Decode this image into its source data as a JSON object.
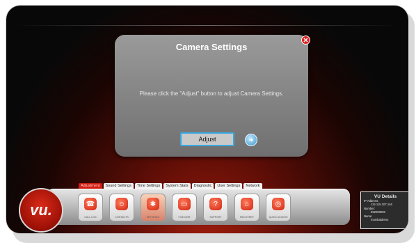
{
  "dialog": {
    "title": "Camera Settings",
    "message": "Please click the \"Adjust\" button to adjust Camera Settings.",
    "adjust_label": "Adjust"
  },
  "tabs": [
    {
      "label": "Adjustment",
      "active": true
    },
    {
      "label": "Sound Settings",
      "active": false
    },
    {
      "label": "Time Settings",
      "active": false
    },
    {
      "label": "System Stats",
      "active": false
    },
    {
      "label": "Diagnostic",
      "active": false
    },
    {
      "label": "User Settings",
      "active": false
    },
    {
      "label": "Network",
      "active": false
    }
  ],
  "logo": {
    "text": "vu."
  },
  "toolbar": [
    {
      "icon": "phone-icon",
      "caption": "CALL LOG",
      "glyph": "☎",
      "selected": false
    },
    {
      "icon": "contacts-icon",
      "caption": "CONTACTS",
      "glyph": "☺",
      "selected": false
    },
    {
      "icon": "settings-icon",
      "caption": "SETTINGS",
      "glyph": "✱",
      "selected": true
    },
    {
      "icon": "folder-icon",
      "caption": "FILE MGR",
      "glyph": "▭",
      "selected": false
    },
    {
      "icon": "support-icon",
      "caption": "SUPPORT",
      "glyph": "?",
      "selected": false
    },
    {
      "icon": "home-icon",
      "caption": "RECOVERY",
      "glyph": "⌂",
      "selected": false
    },
    {
      "icon": "quick-access-icon",
      "caption": "QUICK ACCESS",
      "glyph": "◎",
      "selected": false
    }
  ],
  "vu_details": {
    "title": "VU Details",
    "ip_label": "IP Address:",
    "ip_value": "115.115.107.146",
    "number_label": "Number:",
    "number_value": "992000000",
    "name_label": "Name:",
    "name_value": "mumbaidemo"
  },
  "colors": {
    "accent": "#d21c10",
    "button_border": "#3ba7e0"
  }
}
